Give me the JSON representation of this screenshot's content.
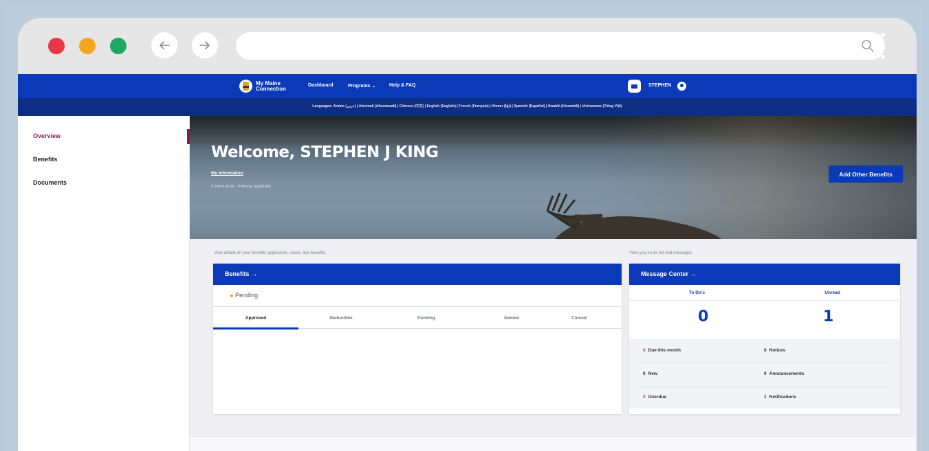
{
  "browser": {
    "colors": {
      "close": "#e63946",
      "minimize": "#f4a620",
      "maximize": "#1ea865"
    },
    "back_icon": "arrow-left-icon",
    "forward_icon": "arrow-right-icon",
    "url": "",
    "search_icon": "search-icon",
    "menu_icon": "kebab-icon"
  },
  "header": {
    "logo_text": "My Maine Connection",
    "nav": [
      "Dashboard",
      "Programs ⌄",
      "Help & FAQ"
    ],
    "username": "STEPHEN",
    "languages": "Languages: Arabic (عربي) | Afsomali (Afsoomaali) | Chinese (中文) | English (English) | French (Français) | Khmer (ខ្មែរ) | Spanish (Español) | Swahili (Kiswahili) | Vietnamese (Tiếng Việt)",
    "brand_color": "#0a3ab8"
  },
  "sidebar": {
    "items": [
      {
        "label": "Overview",
        "active": true
      },
      {
        "label": "Benefits",
        "active": false
      },
      {
        "label": "Documents",
        "active": false
      }
    ]
  },
  "hero": {
    "welcome": "Welcome, STEPHEN J KING",
    "my_info": "My Information",
    "role": "Current Role : Primary Applicant",
    "add_button": "Add Other Benefits"
  },
  "benefits": {
    "hint": "View details on your benefits application, cases, and benefits.",
    "title": "Benefits →",
    "status": "Pending",
    "tabs": [
      "Approved",
      "Deductible",
      "Pending",
      "Denied",
      "Closed"
    ],
    "active_tab": "Approved"
  },
  "message_center": {
    "hint": "View your to-do list and messages.",
    "title": "Message Center →",
    "col1": "To Do's",
    "col2": "Unread",
    "todo_count": "0",
    "unread_count": "1",
    "stats": [
      {
        "num": "0",
        "label": "Due this month",
        "red": true
      },
      {
        "num": "0",
        "label": "Notices",
        "red": false
      },
      {
        "num": "0",
        "label": "New",
        "red": false
      },
      {
        "num": "0",
        "label": "Announcements",
        "red": false
      },
      {
        "num": "0",
        "label": "Overdue",
        "red": true
      },
      {
        "num": "1",
        "label": "Notifications",
        "red": false
      }
    ]
  }
}
